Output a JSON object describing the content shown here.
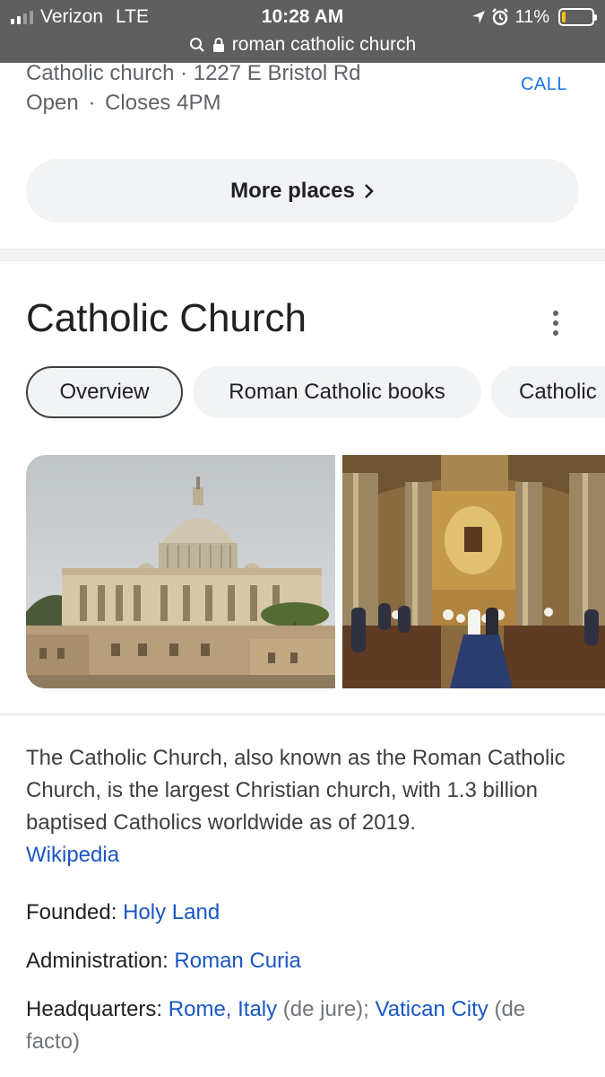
{
  "status_bar": {
    "carrier": "Verizon",
    "network": "LTE",
    "time": "10:28 AM",
    "battery_percent": "11%",
    "battery_level": 0.11,
    "signal_bars_filled": 2,
    "signal_bars_total": 4
  },
  "url_bar": {
    "query": "roman catholic church"
  },
  "place": {
    "address_line": "Catholic church · 1227 E Bristol Rd",
    "hours_open": "Open",
    "hours_sep": "·",
    "hours_close": "Closes 4PM",
    "call_label": "CALL"
  },
  "more_places": {
    "label": "More places"
  },
  "knowledge_panel": {
    "title": "Catholic Church",
    "chips": [
      {
        "label": "Overview",
        "selected": true
      },
      {
        "label": "Roman Catholic books",
        "selected": false
      },
      {
        "label": "Catholic",
        "selected": false
      }
    ],
    "description": "The Catholic Church, also known as the Roman Catholic Church, is the largest Christian church, with 1.3 billion baptised Catholics worldwide as of 2019.",
    "source_link": "Wikipedia",
    "facts": {
      "founded": {
        "label": "Founded: ",
        "value": "Holy Land"
      },
      "administration": {
        "label": "Administration: ",
        "value": "Roman Curia"
      },
      "headquarters": {
        "label": "Headquarters: ",
        "value1": "Rome, Italy",
        "note1": " (de jure); ",
        "value2": "Vatican City",
        "note2": " (de facto)"
      }
    }
  },
  "colors": {
    "link": "#1a56c4",
    "topbar": "#5f5f5f",
    "chip_bg": "#f1f3f4",
    "battery_fill": "#f4c20d"
  }
}
